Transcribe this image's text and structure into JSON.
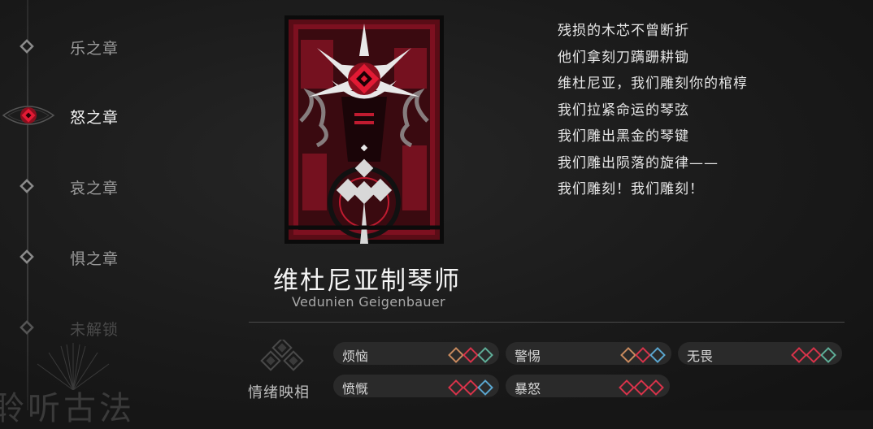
{
  "chapters": [
    {
      "label": "乐之章",
      "state": "normal"
    },
    {
      "label": "怒之章",
      "state": "active"
    },
    {
      "label": "哀之章",
      "state": "normal"
    },
    {
      "label": "惧之章",
      "state": "normal"
    },
    {
      "label": "未解锁",
      "state": "locked"
    }
  ],
  "corner_text": "聆听古法",
  "card": {
    "name_cn": "维杜尼亚制琴师",
    "name_en": "Vedunien Geigenbauer"
  },
  "poem": [
    "残损的木芯不曾断折",
    "他们拿刻刀蹒跚耕锄",
    "维杜尼亚，我们雕刻你的棺椁",
    "我们拉紧命运的琴弦",
    "我们雕出黑金的琴键",
    "我们雕出陨落的旋律——",
    "我们雕刻！我们雕刻！"
  ],
  "emotion_mapping": {
    "title": "情绪映相",
    "items": [
      {
        "label": "烦恼",
        "gems": [
          "orange",
          "red",
          "teal"
        ]
      },
      {
        "label": "警惕",
        "gems": [
          "orange",
          "red",
          "blue"
        ]
      },
      {
        "label": "无畏",
        "gems": [
          "red",
          "red",
          "teal"
        ]
      },
      {
        "label": "愤慨",
        "gems": [
          "red",
          "red",
          "blue"
        ]
      },
      {
        "label": "暴怒",
        "gems": [
          "red",
          "red",
          "red"
        ]
      }
    ]
  },
  "gem_colors": {
    "orange": "#c98a5e",
    "red": "#d8334a",
    "teal": "#5fae98",
    "blue": "#5aa6cf"
  },
  "accent_color": "#c4172c"
}
